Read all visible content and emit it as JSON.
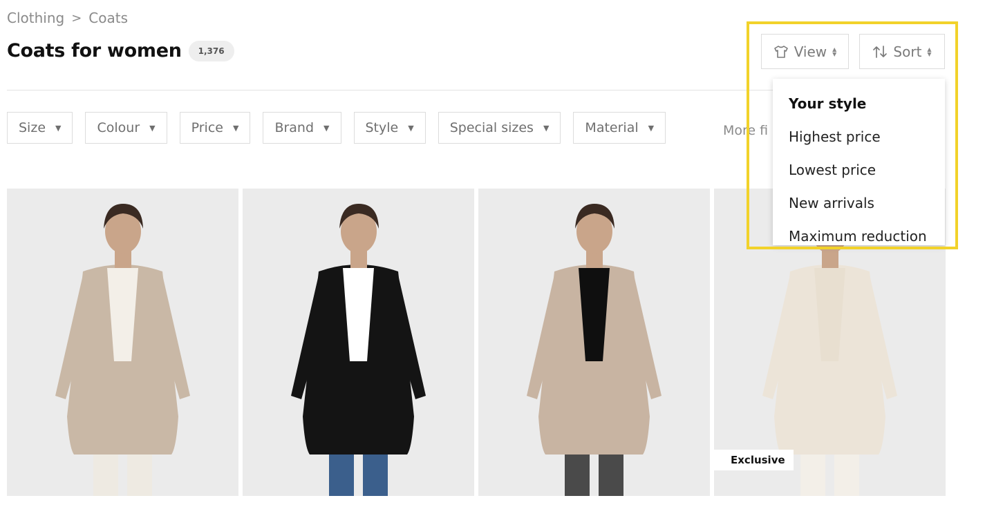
{
  "breadcrumb": {
    "items": [
      "Clothing",
      "Coats"
    ],
    "separator": ">"
  },
  "page": {
    "title": "Coats for women",
    "count": "1,376"
  },
  "filters": [
    "Size",
    "Colour",
    "Price",
    "Brand",
    "Style",
    "Special sizes",
    "Material"
  ],
  "more_filters_label": "More fi",
  "view_button": {
    "label": "View",
    "icon": "shirt-icon"
  },
  "sort_button": {
    "label": "Sort",
    "icon": "sort-arrows-icon"
  },
  "sort_menu": {
    "options": [
      "Your style",
      "Highest price",
      "Lowest price",
      "New arrivals",
      "Maximum reduction"
    ],
    "selected": "Your style"
  },
  "products": [
    {
      "coat_color": "#c9b8a6",
      "inner_color": "#f3efe8",
      "pants_color": "#eeeae2",
      "badge": ""
    },
    {
      "coat_color": "#141414",
      "inner_color": "#ffffff",
      "pants_color": "#3b5f8c",
      "badge": ""
    },
    {
      "coat_color": "#c8b4a2",
      "inner_color": "#0f0f0f",
      "pants_color": "#4a4a4a",
      "badge": ""
    },
    {
      "coat_color": "#ece4d8",
      "inner_color": "#e8dfd0",
      "pants_color": "#f3efe8",
      "badge": "Exclusive"
    }
  ],
  "colors": {
    "highlight": "#f2d22a",
    "border": "#dcdcdc",
    "card_bg": "#ebebeb"
  }
}
